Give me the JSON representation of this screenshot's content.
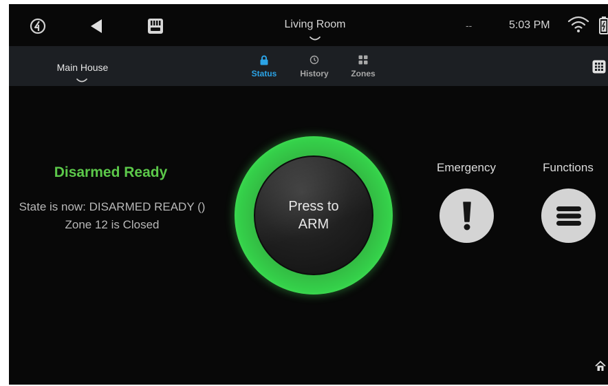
{
  "topbar": {
    "room": "Living Room",
    "dash": "--",
    "time": "5:03 PM",
    "icons": [
      "logo-icon",
      "back-arrow-icon",
      "keypad-icon",
      "wifi-icon",
      "battery-icon"
    ]
  },
  "subbar": {
    "house": "Main House",
    "tabs": [
      {
        "label": "Status",
        "icon": "lock-icon",
        "active": true
      },
      {
        "label": "History",
        "icon": "history-icon",
        "active": false
      },
      {
        "label": "Zones",
        "icon": "zones-icon",
        "active": false
      }
    ],
    "accent": "#2ba3e6"
  },
  "status": {
    "title": "Disarmed Ready",
    "line1": "State is now: DISARMED READY ()",
    "line2": "Zone 12 is Closed",
    "color": "#5cc84a"
  },
  "arm": {
    "label_line1": "Press to",
    "label_line2": "ARM",
    "ring_color": "#35d14a"
  },
  "actions": {
    "emergency": "Emergency",
    "functions": "Functions"
  }
}
